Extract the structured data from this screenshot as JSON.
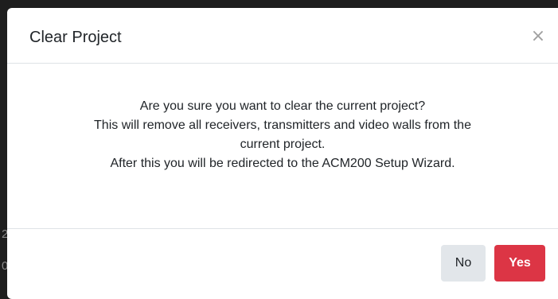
{
  "background": {
    "fragment_top": "2",
    "fragment_bottom": "0"
  },
  "dialog": {
    "title": "Clear Project",
    "close_glyph": "×",
    "message_lines": [
      "Are you sure you want to clear the current project?",
      "This will remove all receivers, transmitters and video walls from the",
      "current project.",
      "After this you will be redirected to the ACM200 Setup Wizard."
    ],
    "no_label": "No",
    "yes_label": "Yes"
  },
  "colors": {
    "danger": "#dc3545",
    "secondary_light": "#e2e6ea",
    "overlay": "#1e1e1e"
  },
  "icons": {
    "close": "close-icon"
  }
}
